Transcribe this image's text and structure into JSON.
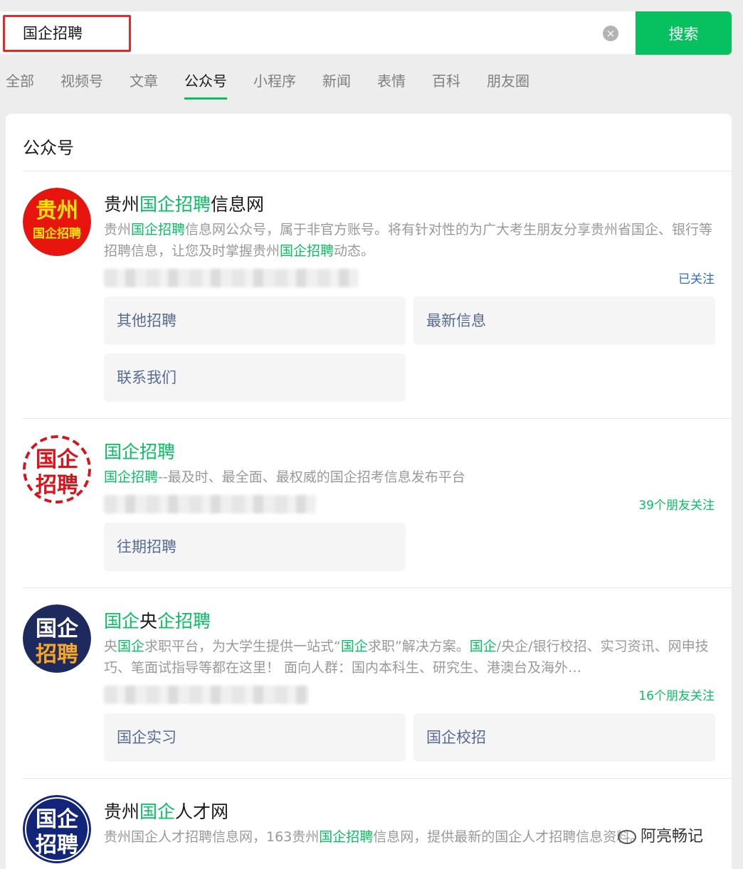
{
  "search": {
    "query": "国企招聘",
    "button_label": "搜索",
    "clear_icon": "×"
  },
  "tabs": [
    {
      "label": "全部"
    },
    {
      "label": "视频号"
    },
    {
      "label": "文章"
    },
    {
      "label": "公众号",
      "active": true
    },
    {
      "label": "小程序"
    },
    {
      "label": "新闻"
    },
    {
      "label": "表情"
    },
    {
      "label": "百科"
    },
    {
      "label": "朋友圈"
    }
  ],
  "section_title": "公众号",
  "accounts": [
    {
      "name_parts": [
        "贵州",
        "国企招聘",
        "信息网"
      ],
      "desc_parts": [
        "贵州",
        "国企招聘",
        "信息网公众号，属于非官方账号。将有针对性的为广大考生朋友分享贵州省国企、银行等招聘信息，让您及时掌握贵州",
        "国企招聘",
        "动态。"
      ],
      "follow": "已关注",
      "avatar_text": [
        "贵州",
        "国企招聘"
      ],
      "menus": [
        "其他招聘",
        "最新信息",
        "联系我们"
      ]
    },
    {
      "name_parts": [
        "国企招聘"
      ],
      "desc_parts": [
        "国企招聘",
        "--最及时、最全面、最权威的国企招考信息发布平台"
      ],
      "follow": "39个朋友关注",
      "avatar_text": [
        "国企",
        "招聘"
      ],
      "menus": [
        "往期招聘"
      ]
    },
    {
      "name_parts": [
        "国企",
        "央",
        "企招聘"
      ],
      "desc_parts": [
        "央",
        "国企",
        "求职平台，为大学生提供一站式“",
        "国企",
        "求职”解决方案。",
        "国企",
        "/央企/银行校招、实习资讯、网申技巧、笔面试指导等都在这里！ 面向人群：国内本科生、研究生、港澳台及海外…"
      ],
      "follow": "16个朋友关注",
      "avatar_text": [
        "国企",
        "招聘"
      ],
      "menus": [
        "国企实习",
        "国企校招"
      ]
    },
    {
      "name_parts": [
        "贵州",
        "国企",
        "人才网"
      ],
      "desc_parts": [
        "贵州国企人才招聘信息网，163贵州",
        "国企招聘",
        "信息网，提供最新的国企人才招聘信息资料。"
      ],
      "avatar_text": [
        "国企",
        "招聘"
      ]
    }
  ],
  "watermark": "阿亮畅记",
  "colors": {
    "accent": "#07c160",
    "link": "#576b95",
    "followed": "#2a6fd6",
    "highlight_box": "#e02b2b"
  },
  "icons": {
    "clear": "clear-icon",
    "watermark": "wechat-icon"
  }
}
